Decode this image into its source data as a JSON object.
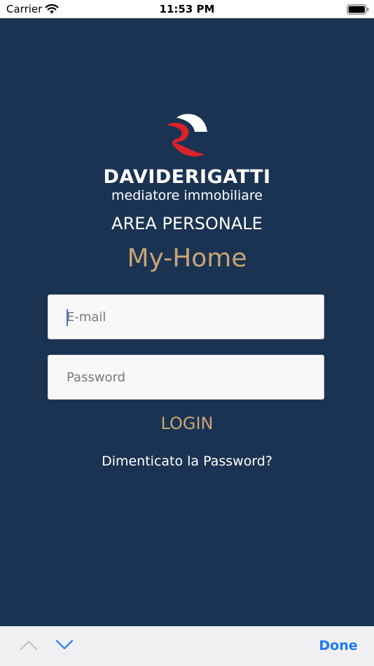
{
  "status_bar": {
    "carrier": "Carrier",
    "time": "11:53 PM"
  },
  "brand": {
    "name": "DAVIDERIGATTI",
    "tagline": "mediatore immobiliare",
    "logo_colors": {
      "red": "#d8232a",
      "white": "#ffffff"
    }
  },
  "section_title": "AREA PERSONALE",
  "app_title": "My-Home",
  "form": {
    "email_placeholder": "E-mail",
    "email_value": "",
    "password_placeholder": "Password",
    "password_value": "",
    "login_label": "LOGIN",
    "forgot_label": "Dimenticato la Password?"
  },
  "keyboard_bar": {
    "prev_icon": "chevron-up-icon",
    "next_icon": "chevron-down-icon",
    "done_label": "Done"
  },
  "colors": {
    "background": "#1b3352",
    "accent_gold": "#c8a574",
    "ios_blue": "#1a7bf2"
  }
}
